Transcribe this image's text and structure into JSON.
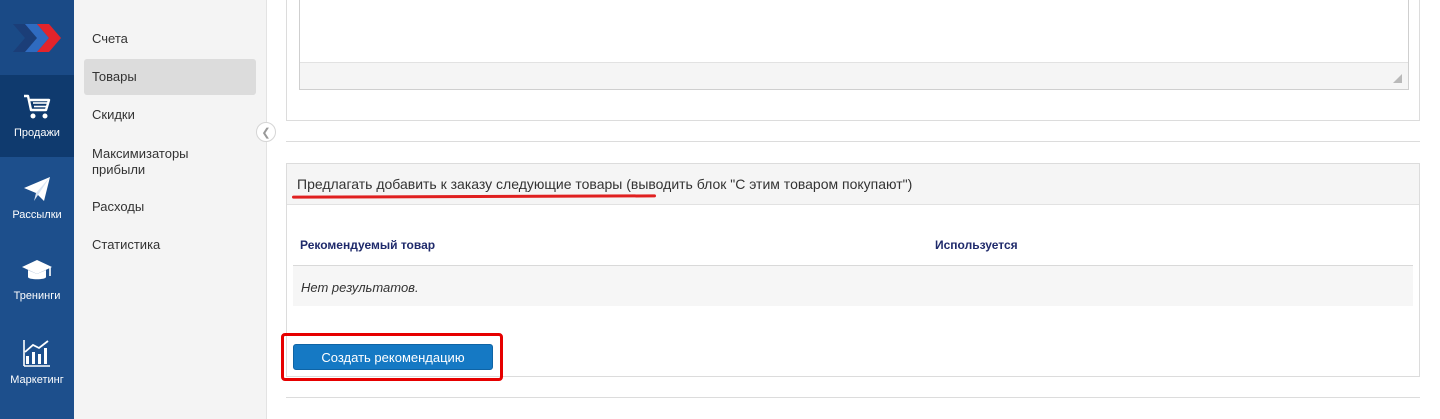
{
  "rail": {
    "items": [
      {
        "label": "Продажи",
        "icon": "cart-icon",
        "active": true
      },
      {
        "label": "Рассылки",
        "icon": "paper-plane-icon",
        "active": false
      },
      {
        "label": "Тренинги",
        "icon": "graduation-cap-icon",
        "active": false
      },
      {
        "label": "Маркетинг",
        "icon": "chart-growth-icon",
        "active": false
      }
    ]
  },
  "sidenav": {
    "items": [
      {
        "label": "Счета"
      },
      {
        "label": "Товары"
      },
      {
        "label": "Скидки"
      },
      {
        "label": "Максимизаторы прибыли"
      },
      {
        "label": "Расходы"
      },
      {
        "label": "Статистика"
      }
    ],
    "active_index": 1
  },
  "card": {
    "title_main": "Предлагать добавить к заказу следующие товары",
    "title_rest": " (выводить блок \"С этим товаром покупают\")",
    "columns": [
      "Рекомендуемый товар",
      "Используется"
    ],
    "empty_text": "Нет результатов.",
    "create_button": "Создать рекомендацию"
  },
  "colors": {
    "rail_bg": "#1d4f8c",
    "accent_button": "#1579c4",
    "annotation_red": "#e60000"
  }
}
